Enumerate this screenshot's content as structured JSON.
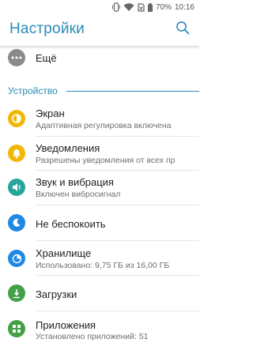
{
  "status_bar": {
    "battery": "70%",
    "time": "10:16"
  },
  "app_bar": {
    "title": "Настройки",
    "search_icon": "search-icon"
  },
  "items_top": [
    {
      "id": "more",
      "title": "Ещё",
      "icon": "more-dots-icon",
      "color": "#8a8a8a"
    }
  ],
  "section": {
    "label": "Устройство"
  },
  "items": [
    {
      "id": "display",
      "title": "Экран",
      "subtitle": "Адаптивная регулировка включена",
      "icon": "brightness-icon",
      "color": "#f2b705"
    },
    {
      "id": "notifications",
      "title": "Уведомления",
      "subtitle": "Разрешены уведомления от всех пр",
      "icon": "bell-icon",
      "color": "#f2b705"
    },
    {
      "id": "sound",
      "title": "Звук и вибрация",
      "subtitle": "Включен вибросигнал",
      "icon": "volume-icon",
      "color": "#26a69a"
    },
    {
      "id": "dnd",
      "title": "Не беспокоить",
      "subtitle": "",
      "icon": "moon-icon",
      "color": "#1e88e5"
    },
    {
      "id": "storage",
      "title": "Хранилище",
      "subtitle": "Использовано: 9,75 ГБ из 16,00 ГБ",
      "icon": "storage-pie-icon",
      "color": "#1e88e5"
    },
    {
      "id": "downloads",
      "title": "Загрузки",
      "subtitle": "",
      "icon": "download-icon",
      "color": "#43a047"
    },
    {
      "id": "apps",
      "title": "Приложения",
      "subtitle": "Установлено приложений: 51",
      "icon": "apps-grid-icon",
      "color": "#43a047"
    }
  ]
}
